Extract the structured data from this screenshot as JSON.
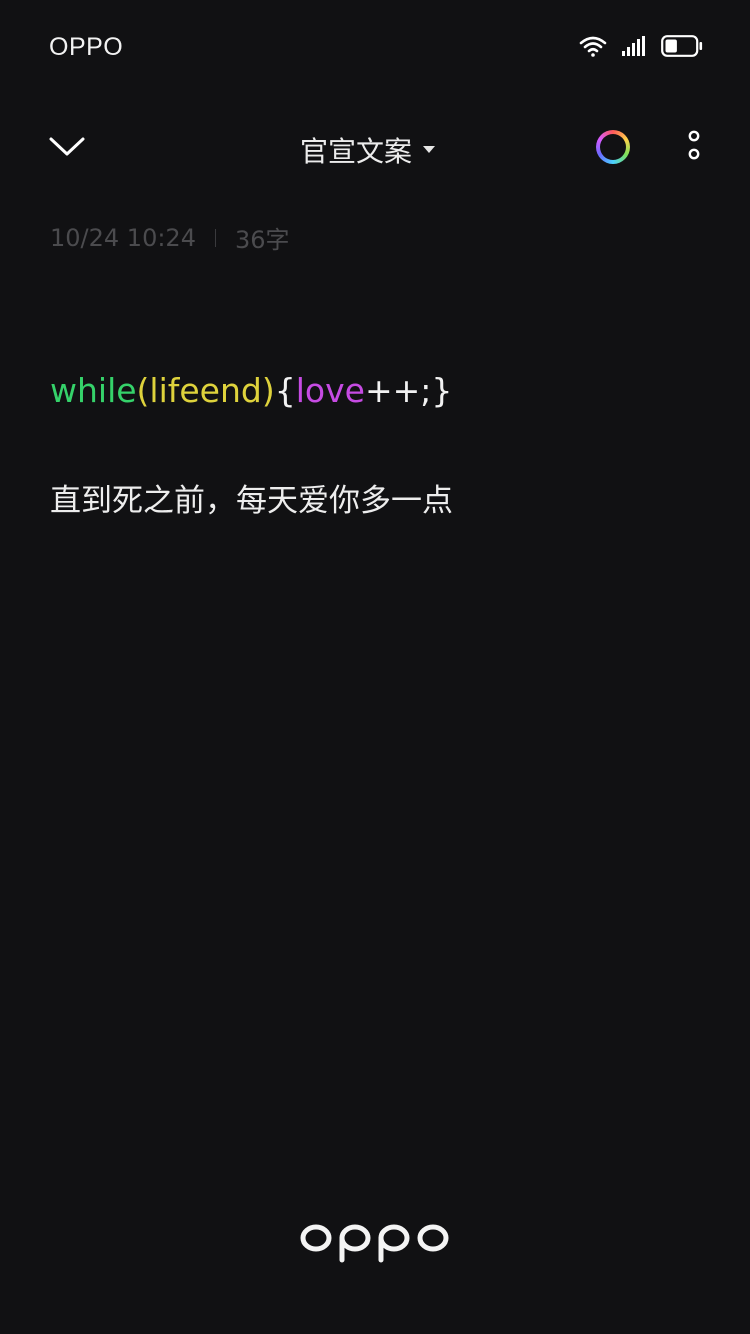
{
  "status_bar": {
    "carrier": "OPPO",
    "icons": [
      "wifi-icon",
      "signal-icon",
      "battery-icon"
    ],
    "battery_level": 0.4
  },
  "toolbar": {
    "back_icon": "chevron-down-icon",
    "folder_title": "官宣文案",
    "dropdown_icon": "caret-down-icon",
    "color_icon": "color-ring-icon",
    "more_icon": "more-vertical-icon"
  },
  "meta": {
    "datetime": "10/24 10:24",
    "char_count": "36字"
  },
  "note": {
    "code_segments": [
      {
        "text": "while",
        "color": "#35d26a"
      },
      {
        "text": "(",
        "color": "#ded23c"
      },
      {
        "text": "lifeend",
        "color": "#ded23c"
      },
      {
        "text": ")",
        "color": "#ded23c"
      },
      {
        "text": "{",
        "color": "#f2f2f2"
      },
      {
        "text": "love",
        "color": "#c64be3"
      },
      {
        "text": "++;}",
        "color": "#f2f2f2"
      }
    ],
    "text_line": "直到死之前，每天爱你多一点"
  },
  "brand": {
    "logo": "oppo",
    "color": "#f4f4f4"
  }
}
